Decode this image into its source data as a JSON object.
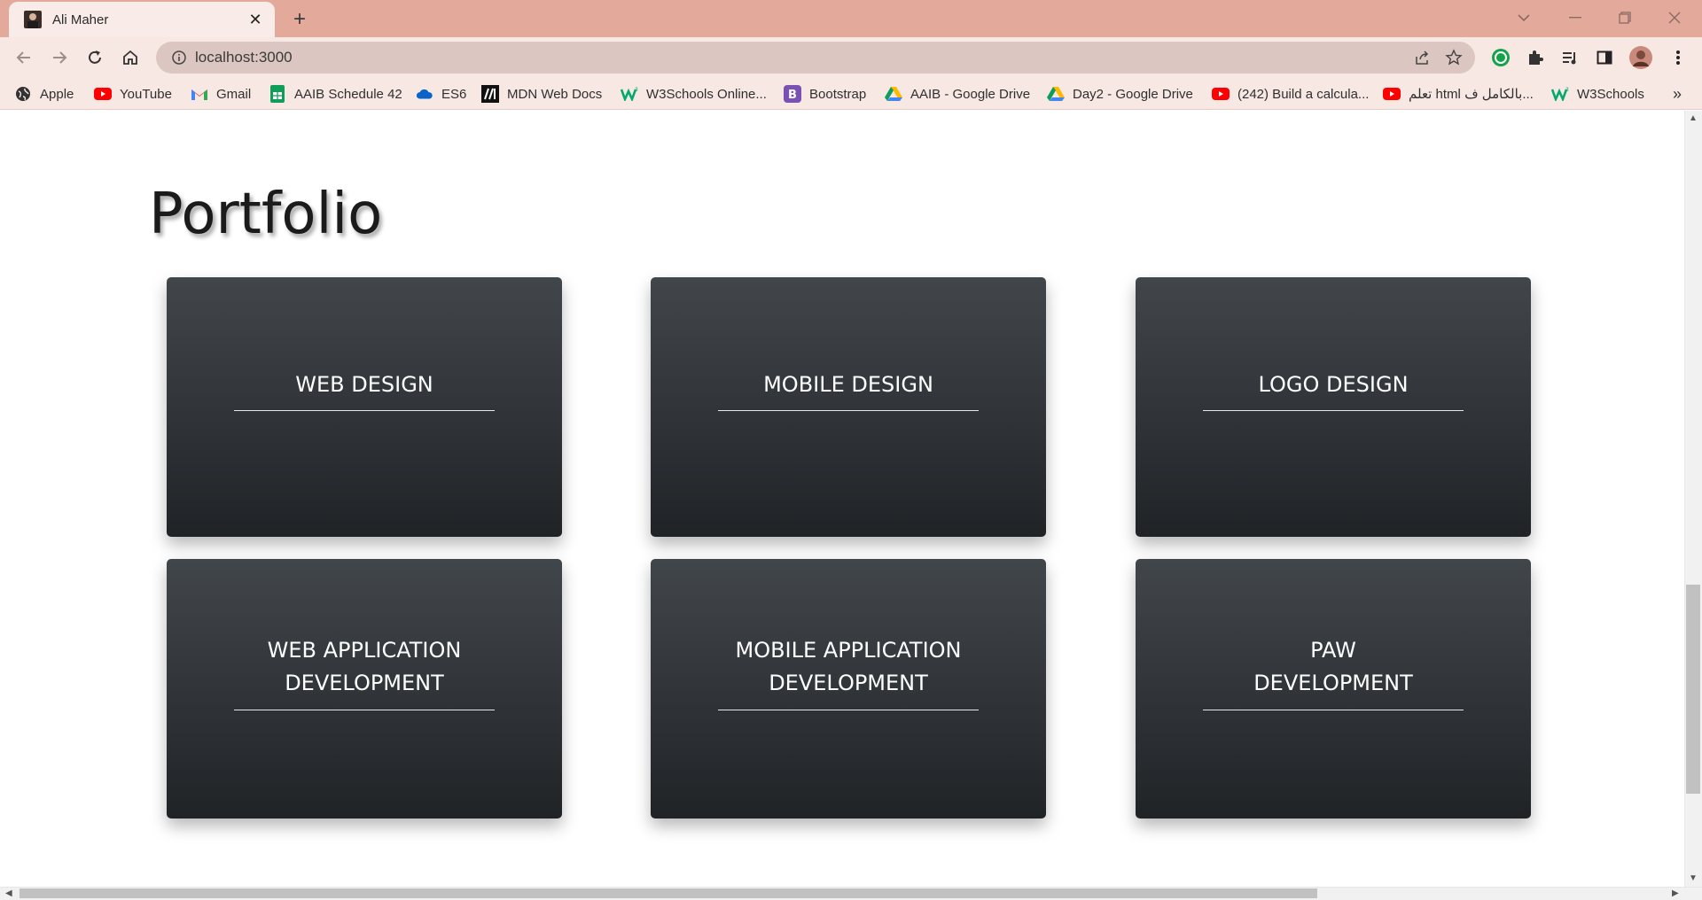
{
  "browser": {
    "tab": {
      "title": "Ali Maher"
    },
    "address": {
      "url": "localhost:3000"
    },
    "bookmarks": [
      {
        "label": "Apple",
        "icon": "apple-globe-icon"
      },
      {
        "label": "YouTube",
        "icon": "youtube-icon"
      },
      {
        "label": "Gmail",
        "icon": "gmail-icon"
      },
      {
        "label": "AAIB Schedule 42",
        "icon": "google-sheets-icon"
      },
      {
        "label": "ES6",
        "icon": "onedrive-icon"
      },
      {
        "label": "MDN Web Docs",
        "icon": "mdn-icon"
      },
      {
        "label": "W3Schools Online...",
        "icon": "w3schools-icon"
      },
      {
        "label": "Bootstrap",
        "icon": "bootstrap-icon"
      },
      {
        "label": "AAIB - Google Drive",
        "icon": "google-drive-icon"
      },
      {
        "label": "Day2 - Google Drive",
        "icon": "google-drive-icon"
      },
      {
        "label": "(242) Build a calcula...",
        "icon": "youtube-icon"
      },
      {
        "label": "تعلم html بالكامل ف...",
        "icon": "youtube-icon"
      },
      {
        "label": "W3Schools",
        "icon": "w3schools-icon"
      }
    ],
    "more_bookmarks": "»"
  },
  "page": {
    "title": "Portfolio",
    "cards": [
      {
        "line1": "WEB DESIGN",
        "line2": ""
      },
      {
        "line1": "MOBILE DESIGN",
        "line2": ""
      },
      {
        "line1": "LOGO DESIGN",
        "line2": ""
      },
      {
        "line1": "WEB APPLICATION",
        "line2": "DEVELOPMENT"
      },
      {
        "line1": "MOBILE APPLICATION",
        "line2": "DEVELOPMENT"
      },
      {
        "line1": "PAW",
        "line2": "DEVELOPMENT"
      }
    ]
  },
  "colors": {
    "tabbar": "#e3aa9b",
    "toolbar": "#f7e8e4",
    "card_top": "#41464b",
    "card_bottom": "#202326"
  }
}
